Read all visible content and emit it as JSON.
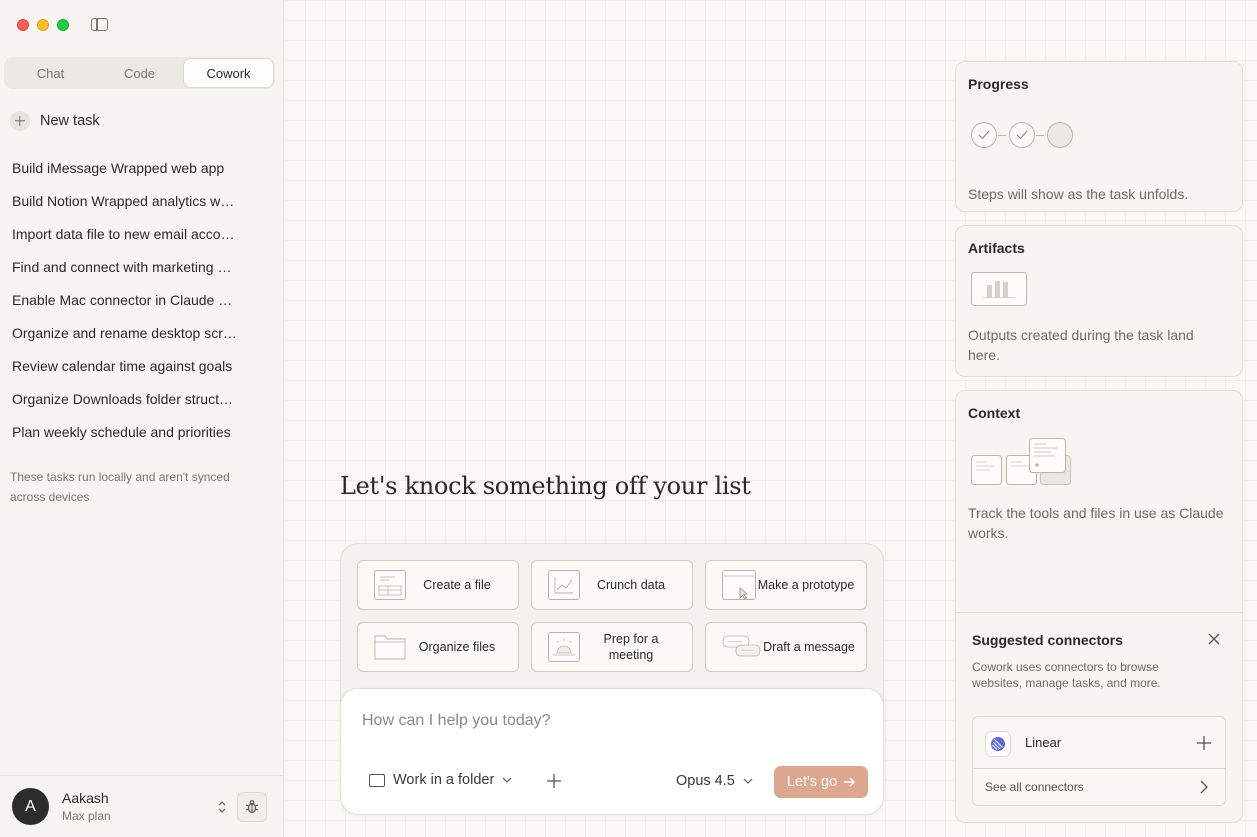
{
  "sidebar": {
    "tabs": [
      {
        "label": "Chat",
        "active": false
      },
      {
        "label": "Code",
        "active": false
      },
      {
        "label": "Cowork",
        "active": true
      }
    ],
    "new_task_label": "New task",
    "tasks": [
      "Build iMessage Wrapped web app",
      "Build Notion Wrapped analytics w…",
      "Import data file to new email acco…",
      "Find and connect with marketing …",
      "Enable Mac connector in Claude …",
      "Organize and rename desktop scr…",
      "Review calendar time against goals",
      "Organize Downloads folder struct…",
      "Plan weekly schedule and priorities"
    ],
    "local_note": "These tasks run locally and aren't synced across devices",
    "user": {
      "initial": "A",
      "name": "Aakash",
      "plan": "Max plan"
    }
  },
  "main": {
    "headline": "Let's knock something off your list",
    "quick_actions": [
      {
        "label": "Create a file",
        "icon": "spreadsheet-icon"
      },
      {
        "label": "Crunch data",
        "icon": "chart-icon"
      },
      {
        "label": "Make a prototype",
        "icon": "prototype-window-icon"
      },
      {
        "label": "Organize files",
        "icon": "folder-icon"
      },
      {
        "label": "Prep for a meeting",
        "icon": "meeting-icon"
      },
      {
        "label": "Draft a message",
        "icon": "message-bubbles-icon"
      }
    ],
    "composer": {
      "placeholder": "How can I help you today?",
      "folder_label": "Work in a folder",
      "model_label": "Opus 4.5",
      "submit_label": "Let's go"
    }
  },
  "panels": {
    "progress": {
      "title": "Progress",
      "description": "Steps will show as the task unfolds.",
      "steps_completed": 2,
      "steps_total": 3
    },
    "artifacts": {
      "title": "Artifacts",
      "description": "Outputs created during the task land here."
    },
    "context": {
      "title": "Context",
      "description": "Track the tools and files in use as Claude works."
    },
    "connectors": {
      "title": "Suggested connectors",
      "description": "Cowork uses connectors to browse websites, manage tasks, and more.",
      "items": [
        {
          "name": "Linear"
        }
      ],
      "see_all_label": "See all connectors"
    }
  },
  "colors": {
    "accent_button": "#dda78f",
    "avatar_bg": "#2c2c2a",
    "linear_brand": "#5e6ad2"
  }
}
